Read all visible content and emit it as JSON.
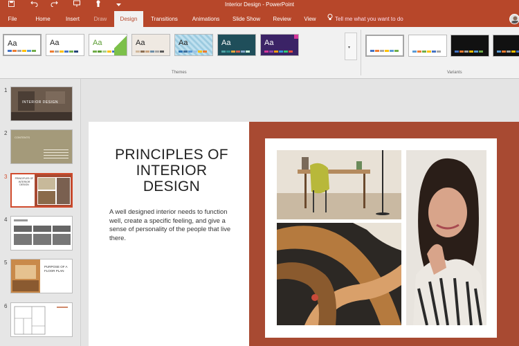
{
  "window": {
    "title": "Interior Design - PowerPoint"
  },
  "quick_access": {
    "save_icon": "save-icon",
    "undo_icon": "undo-icon",
    "redo_icon": "redo-icon",
    "touch_icon": "touch-mode-icon",
    "customize_icon": "customize-icon"
  },
  "tabs": [
    {
      "label": "File"
    },
    {
      "label": "Home"
    },
    {
      "label": "Insert"
    },
    {
      "label": "Draw"
    },
    {
      "label": "Design"
    },
    {
      "label": "Transitions"
    },
    {
      "label": "Animations"
    },
    {
      "label": "Slide Show"
    },
    {
      "label": "Review"
    },
    {
      "label": "View"
    }
  ],
  "tell_me": {
    "label": "Tell me what you want to do"
  },
  "ribbon": {
    "themes_label": "Themes",
    "variants_label": "Variants",
    "theme_sample": "Aa"
  },
  "themes": [
    {
      "bg": "#ffffff",
      "text": "#222222",
      "bars": [
        "#4472c4",
        "#ed7d31",
        "#a5a5a5",
        "#ffc000",
        "#5b9bd5",
        "#70ad47"
      ]
    },
    {
      "bg": "#ffffff",
      "text": "#222222",
      "bars": [
        "#ed7d31",
        "#a5a5a5",
        "#ffc000",
        "#4472c4",
        "#70ad47",
        "#264478"
      ]
    },
    {
      "bg": "#ffffff",
      "text": "#5b9c33",
      "bars": [
        "#70ad47",
        "#5b9c33",
        "#a9d18e",
        "#ffc000",
        "#4472c4",
        "#ed7d31"
      ]
    },
    {
      "bg": "#efe9e2",
      "text": "#222222",
      "bars": [
        "#d1b89c",
        "#8c6f54",
        "#c9a27e",
        "#6f8fa8",
        "#a5a5a5",
        "#5b5b5b"
      ]
    },
    {
      "bg": "#bfe0ef",
      "text": "#1a1a1a",
      "bars": [
        "#2e74b5",
        "#41719c",
        "#5b9bd5",
        "#9dc3e6",
        "#ffc000",
        "#ed7d31"
      ]
    },
    {
      "bg": "#1f4e5a",
      "text": "#ffffff",
      "bars": [
        "#4fa3a5",
        "#2d8a8a",
        "#e3a73f",
        "#d6604d",
        "#8ac",
        "#cfd"
      ]
    },
    {
      "bg": "#3b2366",
      "text": "#ffffff",
      "bars": [
        "#d4379b",
        "#8e44ad",
        "#f39c12",
        "#3498db",
        "#2ecc71",
        "#e74c3c"
      ]
    }
  ],
  "variants": [
    {
      "bg": "#ffffff",
      "bars": [
        "#4472c4",
        "#ed7d31",
        "#a5a5a5",
        "#ffc000",
        "#5b9bd5",
        "#70ad47"
      ]
    },
    {
      "bg": "#ffffff",
      "bars": [
        "#5b9bd5",
        "#ed7d31",
        "#70ad47",
        "#ffc000",
        "#4472c4",
        "#a5a5a5"
      ]
    },
    {
      "bg": "#111111",
      "bars": [
        "#4472c4",
        "#ed7d31",
        "#a5a5a5",
        "#ffc000",
        "#5b9bd5",
        "#70ad47"
      ]
    },
    {
      "bg": "#111111",
      "bars": [
        "#5b9bd5",
        "#ed7d31",
        "#a5a5a5",
        "#ffc000",
        "#4472c4",
        "#70ad47"
      ]
    }
  ],
  "slides_panel": [
    {
      "num": "1",
      "title": "INTERIOR DESIGN"
    },
    {
      "num": "2",
      "title": "CONTENTS"
    },
    {
      "num": "3",
      "title": "PRINCIPLES OF INTERIOR DESIGN",
      "active": true
    },
    {
      "num": "4",
      "title": ""
    },
    {
      "num": "5",
      "title": "PURPOSE OF A FLOOR PLAN"
    },
    {
      "num": "6",
      "title": ""
    }
  ],
  "slide": {
    "title": "PRINCIPLES OF INTERIOR DESIGN",
    "body": "A well designed interior needs to function well, create a specific feeling, and give a sense of personality of the people that live there.",
    "panel_color": "#a84a32"
  }
}
